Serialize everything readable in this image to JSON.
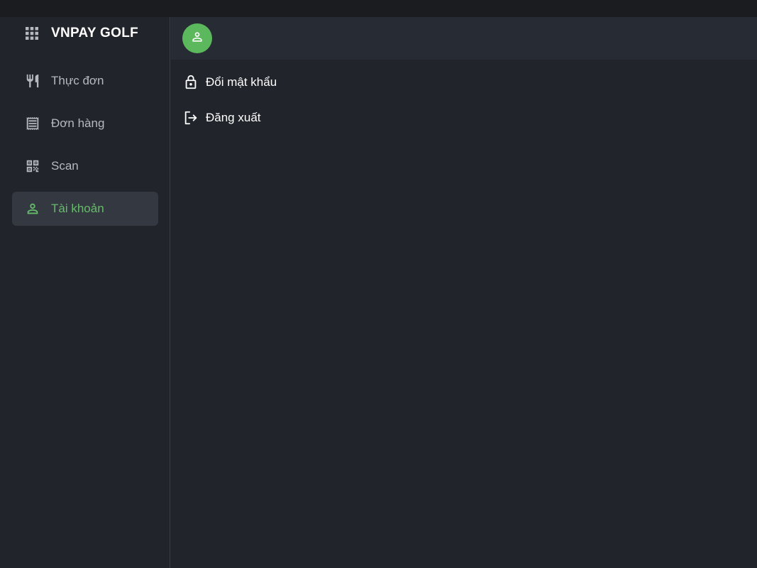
{
  "app": {
    "title": "VNPAY GOLF"
  },
  "sidebar": {
    "items": [
      {
        "label": "Thực đơn",
        "icon": "fork-knife-icon"
      },
      {
        "label": "Đơn hàng",
        "icon": "receipt-icon"
      },
      {
        "label": "Scan",
        "icon": "qr-scan-icon"
      },
      {
        "label": "Tài khoản",
        "icon": "person-icon",
        "active": true
      }
    ]
  },
  "account": {
    "avatar_icon": "person-icon",
    "menu": [
      {
        "label": "Đổi mật khẩu",
        "icon": "lock-icon"
      },
      {
        "label": "Đăng xuất",
        "icon": "logout-icon"
      }
    ]
  },
  "colors": {
    "accent": "#66bb6a",
    "avatar_bg": "#5cb85c",
    "background": "#21242b",
    "active_item_bg": "#343841"
  }
}
